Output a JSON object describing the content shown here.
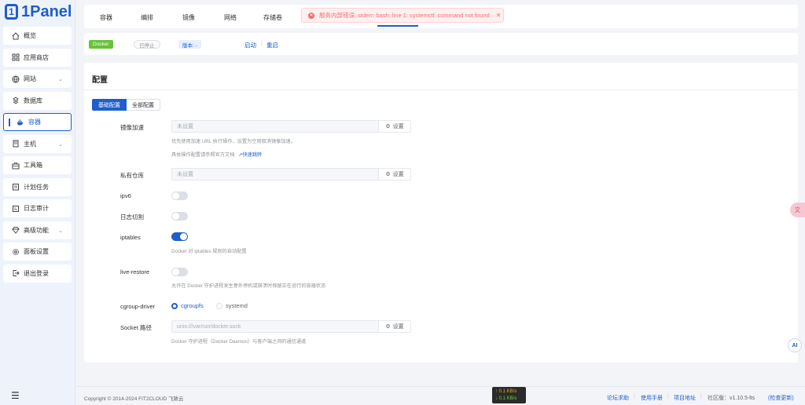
{
  "app": {
    "logo_text": "1Panel"
  },
  "sidebar": {
    "items": [
      {
        "label": "概览",
        "icon": "home-icon"
      },
      {
        "label": "应用商店",
        "icon": "grid-icon"
      },
      {
        "label": "网站",
        "icon": "globe-icon",
        "expandable": true
      },
      {
        "label": "数据库",
        "icon": "database-icon"
      },
      {
        "label": "容器",
        "icon": "docker-icon",
        "active": true
      },
      {
        "label": "主机",
        "icon": "server-icon",
        "expandable": true
      },
      {
        "label": "工具箱",
        "icon": "toolbox-icon"
      },
      {
        "label": "计划任务",
        "icon": "calendar-icon"
      },
      {
        "label": "日志审计",
        "icon": "log-icon"
      },
      {
        "label": "高级功能",
        "icon": "diamond-icon",
        "expandable": true
      },
      {
        "label": "面板设置",
        "icon": "gear-icon"
      },
      {
        "label": "退出登录",
        "icon": "logout-icon"
      }
    ]
  },
  "tabs": [
    "容器",
    "编排",
    "镜像",
    "网络",
    "存储卷"
  ],
  "toast": {
    "message": "服务内部错误: stderr: bash: line 1: systemctl: command not found"
  },
  "status": {
    "docker_tag": "Docker",
    "state": "已停止",
    "version": "版本: -",
    "start": "启动",
    "restart": "重启"
  },
  "panel": {
    "title": "配置",
    "seg_basic": "基础配置",
    "seg_all": "全部配置",
    "mirror": {
      "label": "镜像加速",
      "placeholder": "未设置",
      "button": "设置",
      "hint1": "优先使用加速 URL 执行操作，设置为空则取消镜像加速。",
      "hint2": "具体操作配置请参照官方文档",
      "hint2_link": "快速跳转"
    },
    "registry": {
      "label": "私有仓库",
      "placeholder": "未设置",
      "button": "设置"
    },
    "ipv6": {
      "label": "ipv6",
      "on": false
    },
    "log_rotate": {
      "label": "日志切割",
      "on": false
    },
    "iptables": {
      "label": "iptables",
      "on": true,
      "hint": "Docker 对 iptables 规则的自动配置"
    },
    "live_restore": {
      "label": "live-restore",
      "on": false,
      "hint": "允许在 Docker 守护进程发生意外停机或崩溃时保留正在运行的容器状态"
    },
    "cgroup": {
      "label": "cgroup-driver",
      "opt1": "cgroupfs",
      "opt2": "systemd",
      "selected": "cgroupfs"
    },
    "socket": {
      "label": "Socket 路径",
      "placeholder": "unix:///var/run/docker.sock",
      "button": "设置",
      "hint": "Docker 守护进程（Docker Daemon）与客户端之间的通信通道"
    }
  },
  "footer": {
    "copyright": "Copyright © 2014-2024 FIT2CLOUD 飞致云",
    "net_up": "↑ 0.1 KB/s",
    "net_down": "↓ 0.1 KB/s",
    "forum": "论坛求助",
    "manual": "使用手册",
    "project": "项目地址",
    "edition": "社区版：",
    "version": "v1.10.5-lts",
    "check_update": "(检查更新)"
  },
  "colors": {
    "primary": "#1f5ecb",
    "success": "#67c23a",
    "danger": "#f56c6c"
  }
}
